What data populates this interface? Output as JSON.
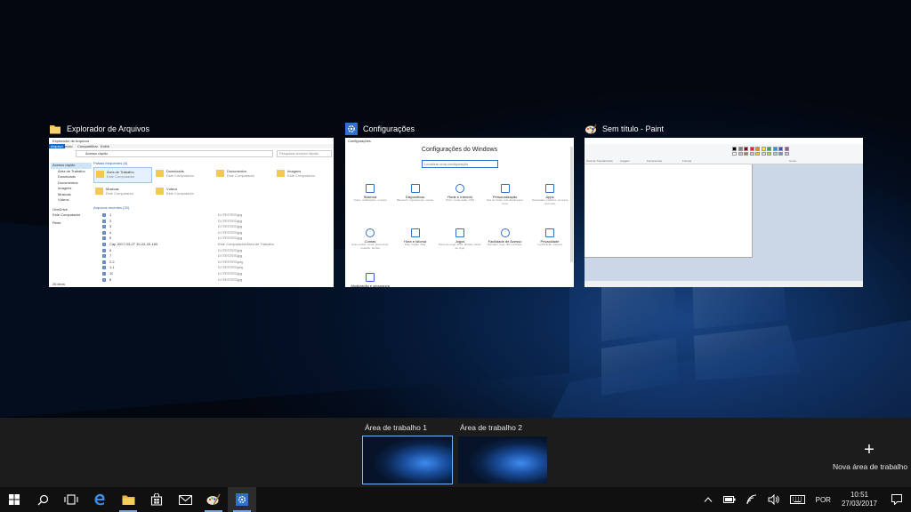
{
  "windows": [
    {
      "title": "Explorador de Arquivos",
      "icon": "folder-icon",
      "content": {
        "titlebar": "Explorador de Arquivos",
        "ribbon_tabs": [
          "Arquivo",
          "Início",
          "Compartilhar",
          "Exibir"
        ],
        "address": "Acesso rápido",
        "search_placeholder": "Pesquisar Acesso rápido",
        "nav": [
          "Acesso rápido",
          "Área de Trabalho",
          "Downloads",
          "Documentos",
          "Imagens",
          "Músicas",
          "Vídeos",
          "OneDrive",
          "Este Computador",
          "Rede"
        ],
        "frequent_header": "Pastas frequentes (6)",
        "frequent": [
          {
            "name": "Área de Trabalho",
            "sub": "Este Computador"
          },
          {
            "name": "Downloads",
            "sub": "Este Computador"
          },
          {
            "name": "Documentos",
            "sub": "Este Computador"
          },
          {
            "name": "Imagens",
            "sub": "Este Computador"
          },
          {
            "name": "Músicas",
            "sub": "Este Computador"
          },
          {
            "name": "Vídeos",
            "sub": "Este Computador"
          }
        ],
        "recent_header": "Arquivos recentes (20)",
        "recent": [
          "1",
          "2",
          "3",
          "4",
          "5",
          "Cap 2017-03-27 10-24-20-160",
          "6",
          "7",
          "2.2",
          "1.1",
          "10",
          "8"
        ],
        "recent_paths": [
          "D:\\TESTES\\jpg",
          "D:\\TESTES\\jpg",
          "D:\\TESTES\\jpg",
          "D:\\TESTES\\jpg",
          "D:\\TESTES\\jpg",
          "Este Computador\\Área de Trabalho",
          "D:\\TESTES\\jpg",
          "D:\\TESTES\\jpg",
          "D:\\TESTES\\png",
          "D:\\TESTES\\png",
          "D:\\TESTES\\jpg",
          "D:\\TESTES\\jpg"
        ],
        "status": "26 itens"
      }
    },
    {
      "title": "Configurações",
      "icon": "gear-icon",
      "content": {
        "titlebar": "Configurações",
        "heading": "Configurações do Windows",
        "search_placeholder": "Localizar uma configuração",
        "tiles": [
          {
            "name": "Sistema",
            "desc": "Vídeo, notificações, energia",
            "icon": "laptop-icon"
          },
          {
            "name": "Dispositivos",
            "desc": "Bluetooth, impressoras, mouse",
            "icon": "devices-icon"
          },
          {
            "name": "Rede e Internet",
            "desc": "Wi-Fi, modo avião, VPN",
            "icon": "globe-icon"
          },
          {
            "name": "Personalização",
            "desc": "Tela de fundo, tela de bloqueio, cores",
            "icon": "brush-icon"
          },
          {
            "name": "Apps",
            "desc": "Desinstalar, padrões, recursos opcionais",
            "icon": "apps-list-icon"
          },
          {
            "name": "Contas",
            "desc": "Suas contas, email, sincronizar, trabalho, família",
            "icon": "person-icon"
          },
          {
            "name": "Hora e Idioma",
            "desc": "Fala, região, data",
            "icon": "clock-language-icon"
          },
          {
            "name": "Jogos",
            "desc": "Barra de Jogo, DVR, difusão, Modo de Jogo",
            "icon": "xbox-icon"
          },
          {
            "name": "Facilidade de Acesso",
            "desc": "Narrador, lupa, alto contraste",
            "icon": "ease-of-access-icon"
          },
          {
            "name": "Privacidade",
            "desc": "Localização, câmera",
            "icon": "lock-icon"
          },
          {
            "name": "Atualização e segurança",
            "desc": "",
            "icon": "update-icon"
          }
        ]
      }
    },
    {
      "title": "Sem título - Paint",
      "icon": "paint-icon",
      "content": {
        "ribbon_groups": [
          "Área de Transferência",
          "Imagem",
          "Ferramentas",
          "Formas",
          "Cores"
        ]
      }
    }
  ],
  "desktops": [
    {
      "label": "Área de trabalho 1",
      "active": true
    },
    {
      "label": "Área de trabalho 2",
      "active": false
    }
  ],
  "new_desktop_label": "Nova área de trabalho",
  "taskbar": {
    "items": [
      {
        "name": "start-button",
        "icon": "windows-logo-icon"
      },
      {
        "name": "search-button",
        "icon": "search-icon"
      },
      {
        "name": "task-view-button",
        "icon": "task-view-icon"
      },
      {
        "name": "taskbar-edge",
        "icon": "edge-icon"
      },
      {
        "name": "taskbar-file-explorer",
        "icon": "folder-icon"
      },
      {
        "name": "taskbar-store",
        "icon": "store-icon"
      },
      {
        "name": "taskbar-mail",
        "icon": "mail-icon"
      },
      {
        "name": "taskbar-paint",
        "icon": "paint-icon"
      },
      {
        "name": "taskbar-settings",
        "icon": "gear-icon"
      }
    ],
    "language": "POR",
    "time": "10:51",
    "date": "27/03/2017"
  },
  "colors": {
    "accent": "#3a78d0",
    "taskbar": "#101010",
    "desktop_bar": "#1c1c1c"
  }
}
